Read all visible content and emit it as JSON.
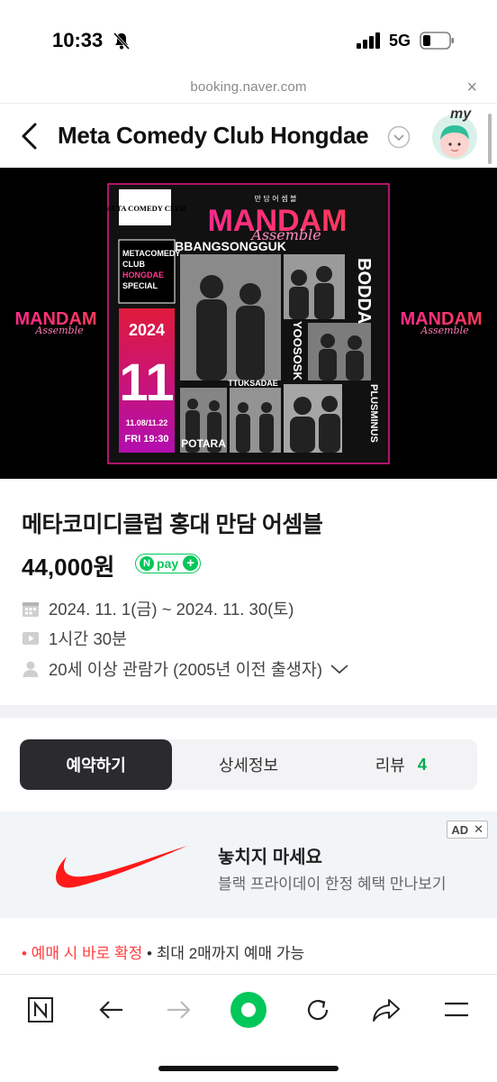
{
  "status_bar": {
    "time": "10:33",
    "network": "5G"
  },
  "browser": {
    "url": "booking.naver.com",
    "close": "×"
  },
  "header": {
    "title": "Meta Comedy Club Hongdae",
    "avatar_badge": "my"
  },
  "poster": {
    "side_brand_left": "MANDAM",
    "side_brand_right": "MANDAM",
    "side_script": "Assemble",
    "club_logo": "META COMEDY CLUB",
    "korean_small": "만 담 어 셈 블",
    "main_title": "MANDAM",
    "script": "Assemble",
    "club_box": [
      "METACOMEDY",
      "CLUB",
      "HONGDAE",
      "SPECIAL"
    ],
    "year": "2024",
    "month": "11",
    "dates": "11.08/11.22",
    "showtime": "FRI 19:30",
    "teams": [
      "BBANGSONGGUK",
      "BODDA",
      "YOOSOSK",
      "PLUSMINUS",
      "TTUKSADAE",
      "POTARA"
    ]
  },
  "product": {
    "title": "메타코미디클럽 홍대 만담 어셈블",
    "price": "44,000원",
    "npay_label": "pay",
    "date_range": "2024. 11. 1(금) ~ 2024. 11. 30(토)",
    "duration": "1시간 30분",
    "age": "20세 이상 관람가 (2005년 이전 출생자)"
  },
  "tabs": [
    {
      "label": "예약하기",
      "active": true
    },
    {
      "label": "상세정보",
      "active": false
    },
    {
      "label": "리뷰",
      "count": "4",
      "active": false
    }
  ],
  "ad": {
    "badge": "AD",
    "title": "놓치지 마세요",
    "subtitle": "블랙 프라이데이 한정 혜택 만나보기"
  },
  "notice": {
    "highlight": "• 예매 시 바로 확정",
    "rest": " • 최대 2매까지 예매 가능"
  },
  "colors": {
    "naver_green": "#03c75a",
    "accent_red": "#ff3e3e",
    "poster_magenta": "#e8198b"
  }
}
